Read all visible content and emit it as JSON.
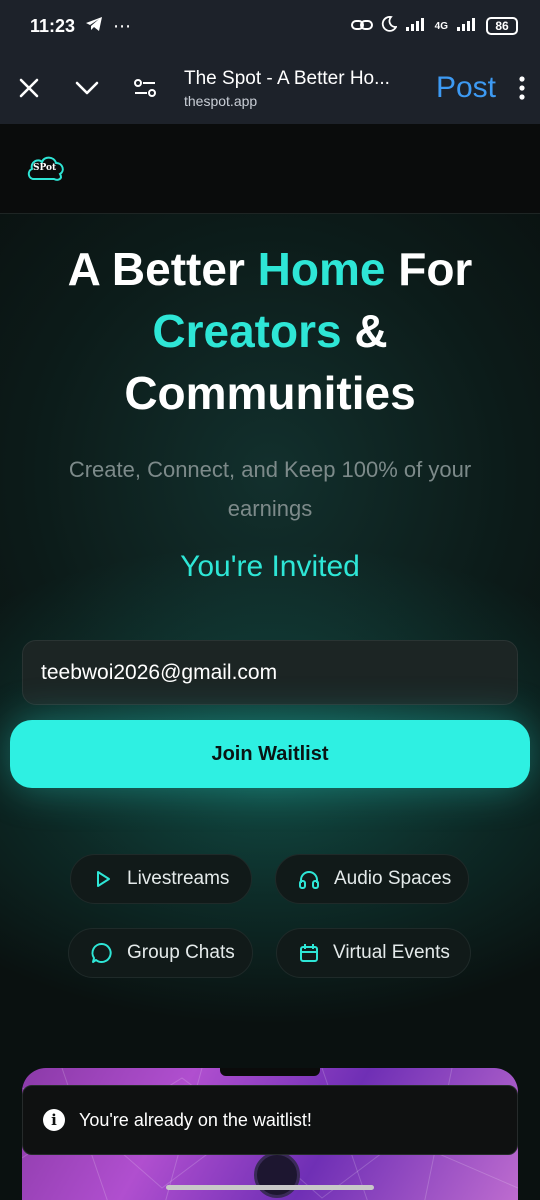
{
  "status_bar": {
    "time": "11:23",
    "network": "4G",
    "battery": "86"
  },
  "browser": {
    "title": "The Spot - A Better Ho...",
    "url": "thespot.app",
    "post_label": "Post"
  },
  "site": {
    "logo_text": "SPot"
  },
  "hero": {
    "line1_a": "A Better ",
    "line1_b": "Home",
    "line1_c": " For",
    "line2_a": "Creators",
    "line2_b": " &",
    "line3": "Communities",
    "subtitle": "Create, Connect, and Keep 100% of your earnings",
    "invited": "You're Invited",
    "email_value": "teebwoi2026@gmail.com",
    "join_label": "Join Waitlist"
  },
  "features": [
    {
      "label": "Livestreams",
      "icon": "play-icon"
    },
    {
      "label": "Audio Spaces",
      "icon": "headphones-icon"
    },
    {
      "label": "Group Chats",
      "icon": "chat-bubble-icon"
    },
    {
      "label": "Virtual Events",
      "icon": "calendar-icon"
    }
  ],
  "toast": {
    "message": "You're already on the waitlist!",
    "icon": "info-icon"
  },
  "colors": {
    "accent": "#2ee6d6",
    "button": "#2ef0e2",
    "link": "#3d9af3"
  }
}
